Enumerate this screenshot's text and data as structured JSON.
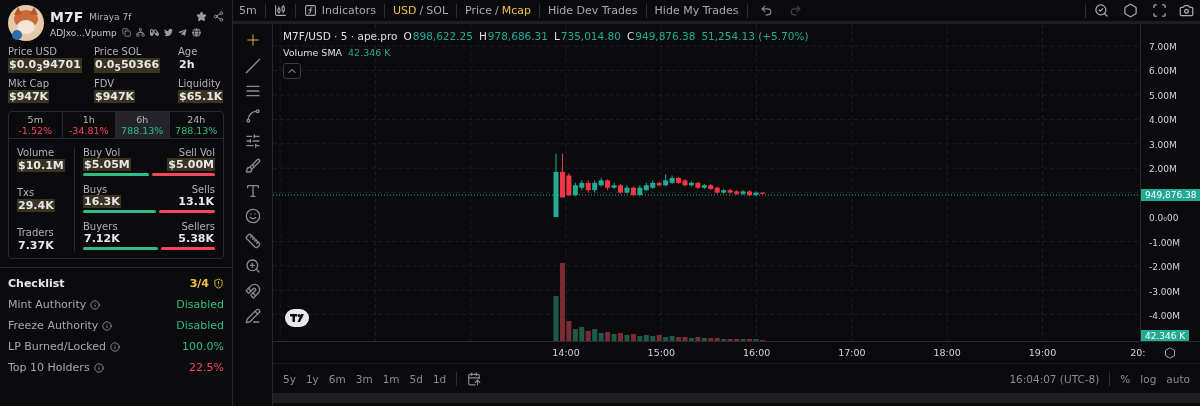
{
  "token": {
    "symbol": "M7F",
    "name": "Miraya 7f",
    "address": "ADJxo...Vpump"
  },
  "stats": [
    {
      "label": "Price USD",
      "value": "$0.0$_{3}$94701",
      "highlighted": true
    },
    {
      "label": "Price SOL",
      "value": "0.0$_{5}$50366",
      "highlighted": true
    },
    {
      "label": "Age",
      "value": "2h",
      "highlighted": false
    },
    {
      "label": "Mkt Cap",
      "value": "$947K",
      "highlighted": true
    },
    {
      "label": "FDV",
      "value": "$947K",
      "highlighted": true
    },
    {
      "label": "Liquidity",
      "value": "$65.1K",
      "highlighted": true
    }
  ],
  "periods": [
    {
      "label": "5m",
      "change": "-1.52%",
      "color": "#f6465d",
      "selected": false
    },
    {
      "label": "1h",
      "change": "-34.81%",
      "color": "#f6465d",
      "selected": false
    },
    {
      "label": "6h",
      "change": "788.13%",
      "color": "#2ebd85",
      "selected": true
    },
    {
      "label": "24h",
      "change": "788.13%",
      "color": "#2ebd85",
      "selected": false
    }
  ],
  "activity": [
    {
      "label": "Volume",
      "value": "$10.1M",
      "highlighted": true,
      "buy_label": "Buy Vol",
      "buy_value": "$5.05M",
      "sell_label": "Sell Vol",
      "sell_value": "$5.00M",
      "level": 0.5
    },
    {
      "label": "Txs",
      "value": "29.4K",
      "highlighted": true,
      "buy_label": "Buys",
      "buy_value": "16.3K",
      "sell_label": "Sells",
      "sell_value": "13.1K",
      "level": 0.55
    },
    {
      "label": "Traders",
      "value": "7.37K",
      "highlighted": false,
      "buy_label": "Buyers",
      "buy_value": "7.12K",
      "sell_label": "Sellers",
      "sell_value": "5.38K",
      "level": 0.57
    }
  ],
  "checklist": {
    "title": "Checklist",
    "score": "3/4",
    "items": [
      {
        "label": "Mint Authority",
        "value": "Disabled",
        "color": "#2ebd85"
      },
      {
        "label": "Freeze Authority",
        "value": "Disabled",
        "color": "#2ebd85"
      },
      {
        "label": "LP Burned/Locked",
        "value": "100.0%",
        "color": "#2ebd85"
      },
      {
        "label": "Top 10 Holders",
        "value": "22.5%",
        "color": "#f6465d"
      }
    ]
  },
  "toolbar": {
    "interval": "5m",
    "indicators": "Indicators",
    "currency": [
      {
        "label": "USD",
        "selected": true
      },
      {
        "label": "SOL",
        "selected": false
      }
    ],
    "mode": [
      {
        "label": "Price",
        "selected": false
      },
      {
        "label": "Mcap",
        "selected": true
      }
    ],
    "separator": "/",
    "buttons": [
      "Hide Dev Trades",
      "Hide My Trades"
    ]
  },
  "chart": {
    "title": "M7F/USD · 5 · ape.pro",
    "ohlc": [
      {
        "key": "O",
        "value": "898,622.25"
      },
      {
        "key": "H",
        "value": "978,686.31"
      },
      {
        "key": "L",
        "value": "735,014.80"
      },
      {
        "key": "C",
        "value": "949,876.38"
      }
    ],
    "change": "51,254.13 (+5.70%)",
    "volume_label": "Volume SMA",
    "volume_value": "42.346 K",
    "price_ticks": [
      "7.00M",
      "6.00M",
      "5.00M",
      "4.00M",
      "3.00M",
      "2.00M",
      "0.0₀00",
      "-1.00M",
      "-2.00M",
      "-3.00M",
      "-4.00M"
    ],
    "price_tag": "949,876.38",
    "volume_tag": "42.346 K",
    "time_ticks": [
      "14:00",
      "15:00",
      "16:00",
      "17:00",
      "18:00",
      "19:00",
      "20:"
    ]
  },
  "ranges": [
    "5y",
    "1y",
    "6m",
    "3m",
    "1m",
    "5d",
    "1d"
  ],
  "status": {
    "time": "16:04:07 (UTC-8)",
    "options": [
      "%",
      "log",
      "auto"
    ]
  }
}
